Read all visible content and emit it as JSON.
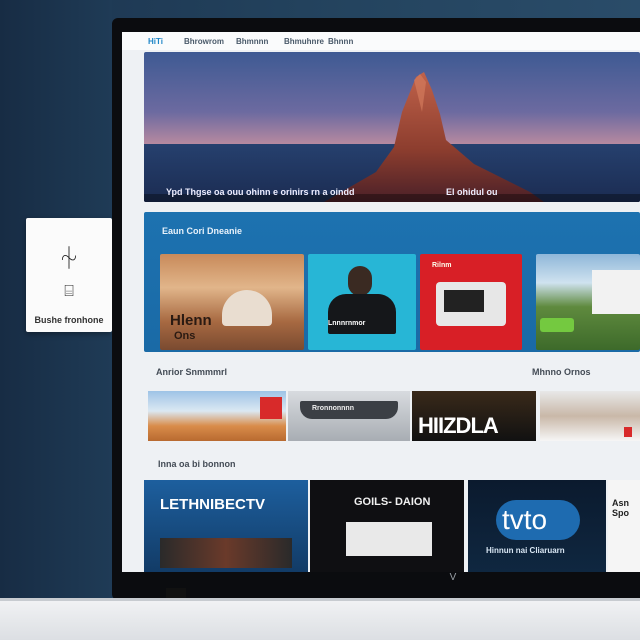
{
  "wall_sign": {
    "label": "Bushe fronhone",
    "symbol_top": "⏆",
    "symbol_bottom": "⌸"
  },
  "nav": {
    "items": [
      "HiTi",
      "Bhrowrom",
      "Bhmnnn",
      "Bhmuhnre",
      "Bhnnn"
    ]
  },
  "hero": {
    "caption_left": "Ypd Thgse oa ouu ohinn e orinirs rn a oindd",
    "caption_right": "El ohidul ou"
  },
  "featured": {
    "title": "Eaun Cori Dneanie",
    "cards": [
      {
        "title": "Hlenn",
        "subtitle": "Ons"
      },
      {
        "title": "Lnnnrnmor"
      },
      {
        "title": "Rilnm"
      },
      {
        "title": ""
      }
    ]
  },
  "row1": {
    "title": "Anrior Snmmmrl",
    "title_right": "Mhnno Ornos",
    "tiles": [
      {
        "title": ""
      },
      {
        "title": "Rronnonnnn"
      },
      {
        "title": "HIIZDLA"
      },
      {
        "title": ""
      }
    ]
  },
  "row2": {
    "title": "Inna oa bi bonnon",
    "tiles": [
      {
        "title": "LETHNIBECTV"
      },
      {
        "title": "GOILS- DAION"
      },
      {
        "title": "tvto",
        "subtitle": "Hinnun nai Cliaruarn"
      },
      {
        "title": "Asn Spo"
      }
    ]
  },
  "tv": {
    "logo": "V"
  },
  "colors": {
    "accent": "#1f86c7",
    "featured_bg": "#1a6aa6",
    "screen_bg": "#eef1f4"
  }
}
